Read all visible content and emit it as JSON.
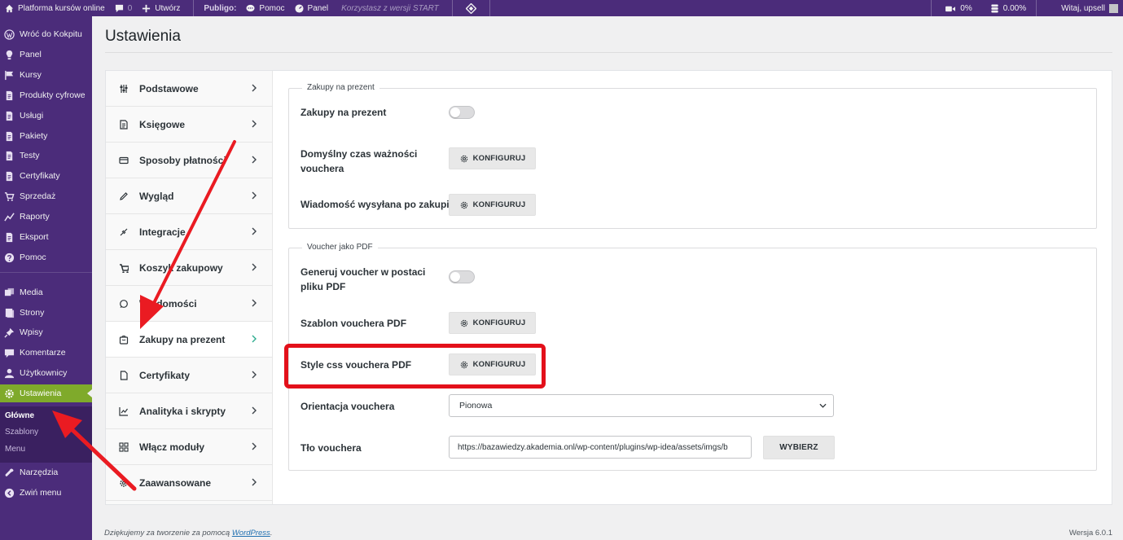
{
  "adminbar": {
    "site_name": "Platforma kursów online",
    "comments_count": "0",
    "new_label": "Utwórz",
    "brand": "Publigo:",
    "help_label": "Pomoc",
    "panel_label": "Panel",
    "version_note": "Korzystasz z wersji START",
    "video_stat": "0%",
    "storage_stat": "0.00%",
    "greeting": "Witaj, upsell"
  },
  "sidebar": {
    "items": [
      {
        "label": "Wróć do Kokpitu",
        "icon": "wordpress-icon"
      },
      {
        "label": "Panel",
        "icon": "bulb-icon"
      },
      {
        "label": "Kursy",
        "icon": "flag-icon"
      },
      {
        "label": "Produkty cyfrowe",
        "icon": "document-icon"
      },
      {
        "label": "Usługi",
        "icon": "document-icon"
      },
      {
        "label": "Pakiety",
        "icon": "document-icon"
      },
      {
        "label": "Testy",
        "icon": "document-icon"
      },
      {
        "label": "Certyfikaty",
        "icon": "document-icon"
      },
      {
        "label": "Sprzedaż",
        "icon": "cart-icon"
      },
      {
        "label": "Raporty",
        "icon": "chart-icon"
      },
      {
        "label": "Eksport",
        "icon": "document-icon"
      },
      {
        "label": "Pomoc",
        "icon": "help-icon"
      },
      {
        "label": "Media",
        "icon": "media-icon"
      },
      {
        "label": "Strony",
        "icon": "page-icon"
      },
      {
        "label": "Wpisy",
        "icon": "pin-icon"
      },
      {
        "label": "Komentarze",
        "icon": "comment-icon"
      },
      {
        "label": "Użytkownicy",
        "icon": "user-icon"
      },
      {
        "label": "Ustawienia",
        "icon": "settings-icon"
      },
      {
        "label": "Narzędzia",
        "icon": "wrench-icon"
      },
      {
        "label": "Zwiń menu",
        "icon": "collapse-icon"
      }
    ],
    "submenu": [
      "Główne",
      "Szablony",
      "Menu"
    ]
  },
  "page": {
    "title": "Ustawienia"
  },
  "nav": {
    "items": [
      {
        "label": "Podstawowe",
        "icon": "sliders-icon"
      },
      {
        "label": "Księgowe",
        "icon": "invoice-icon"
      },
      {
        "label": "Sposoby płatności",
        "icon": "credit-card-icon"
      },
      {
        "label": "Wygląd",
        "icon": "pencil-icon"
      },
      {
        "label": "Integracje",
        "icon": "plug-icon"
      },
      {
        "label": "Koszyk zakupowy",
        "icon": "cart-icon"
      },
      {
        "label": "Wiadomości",
        "icon": "message-icon"
      },
      {
        "label": "Zakupy na prezent",
        "icon": "gift-icon"
      },
      {
        "label": "Certyfikaty",
        "icon": "file-icon"
      },
      {
        "label": "Analityka i skrypty",
        "icon": "analytics-icon"
      },
      {
        "label": "Włącz moduły",
        "icon": "grid-icon"
      },
      {
        "label": "Zaawansowane",
        "icon": "gear-icon"
      }
    ]
  },
  "gift_section": {
    "legend": "Zakupy na prezent",
    "toggle_label": "Zakupy na prezent",
    "validity_label": "Domyślny czas ważności vouchera",
    "message_label": "Wiadomość wysyłana po zakupie"
  },
  "pdf_section": {
    "legend": "Voucher jako PDF",
    "generate_label": "Generuj voucher w postaci pliku PDF",
    "template_label": "Szablon vouchera PDF",
    "css_label": "Style css vouchera PDF",
    "orientation_label": "Orientacja vouchera",
    "orientation_value": "Pionowa",
    "background_label": "Tło vouchera",
    "background_value": "https://bazawiedzy.akademia.onl/wp-content/plugins/wp-idea/assets/imgs/b",
    "choose_label": "WYBIERZ"
  },
  "buttons": {
    "configure_label": "KONFIGURUJ"
  },
  "footer": {
    "thanks_prefix": "Dziękujemy za tworzenie za pomocą ",
    "thanks_link": "WordPress",
    "thanks_suffix": ".",
    "version": "Wersja 6.0.1"
  },
  "colors": {
    "sidebar_bg": "#4b2c7a",
    "active_green": "#7faa2b",
    "highlight_red": "#e3101a",
    "annotation_arrow": "#ea1b22"
  }
}
